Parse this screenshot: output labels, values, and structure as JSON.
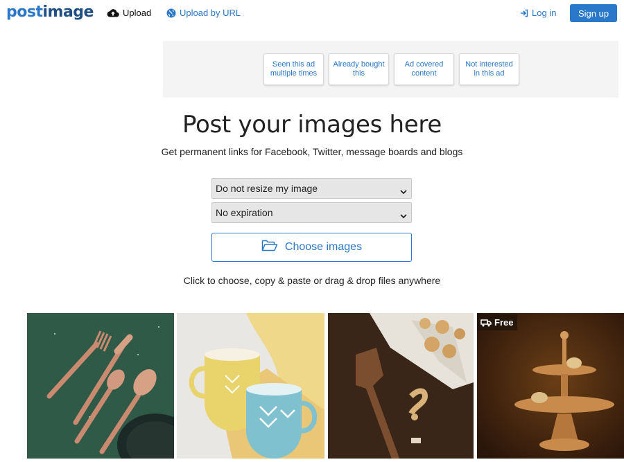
{
  "header": {
    "logo_post": "post",
    "logo_image": "image",
    "upload_label": "Upload",
    "upload_url_label": "Upload by URL",
    "login_label": "Log in",
    "signup_label": "Sign up"
  },
  "ad": {
    "options": [
      "Seen this ad multiple times",
      "Already bought this",
      "Ad covered content",
      "Not interested in this ad"
    ]
  },
  "hero": {
    "title": "Post your images here",
    "subtitle": "Get permanent links for Facebook, Twitter, message boards and blogs"
  },
  "form": {
    "resize_value": "Do not resize my image",
    "expiration_value": "No expiration",
    "choose_label": "Choose images",
    "hint": "Click to choose, copy & paste or drag & drop files anywhere"
  },
  "gallery": {
    "badge_label": "Free"
  },
  "colors": {
    "accent": "#2a78c9",
    "logo_dark": "#1f4f82"
  },
  "icons": [
    "cloud-upload-icon",
    "globe-icon",
    "login-icon",
    "caret-down-icon",
    "folder-open-icon",
    "truck-icon"
  ]
}
